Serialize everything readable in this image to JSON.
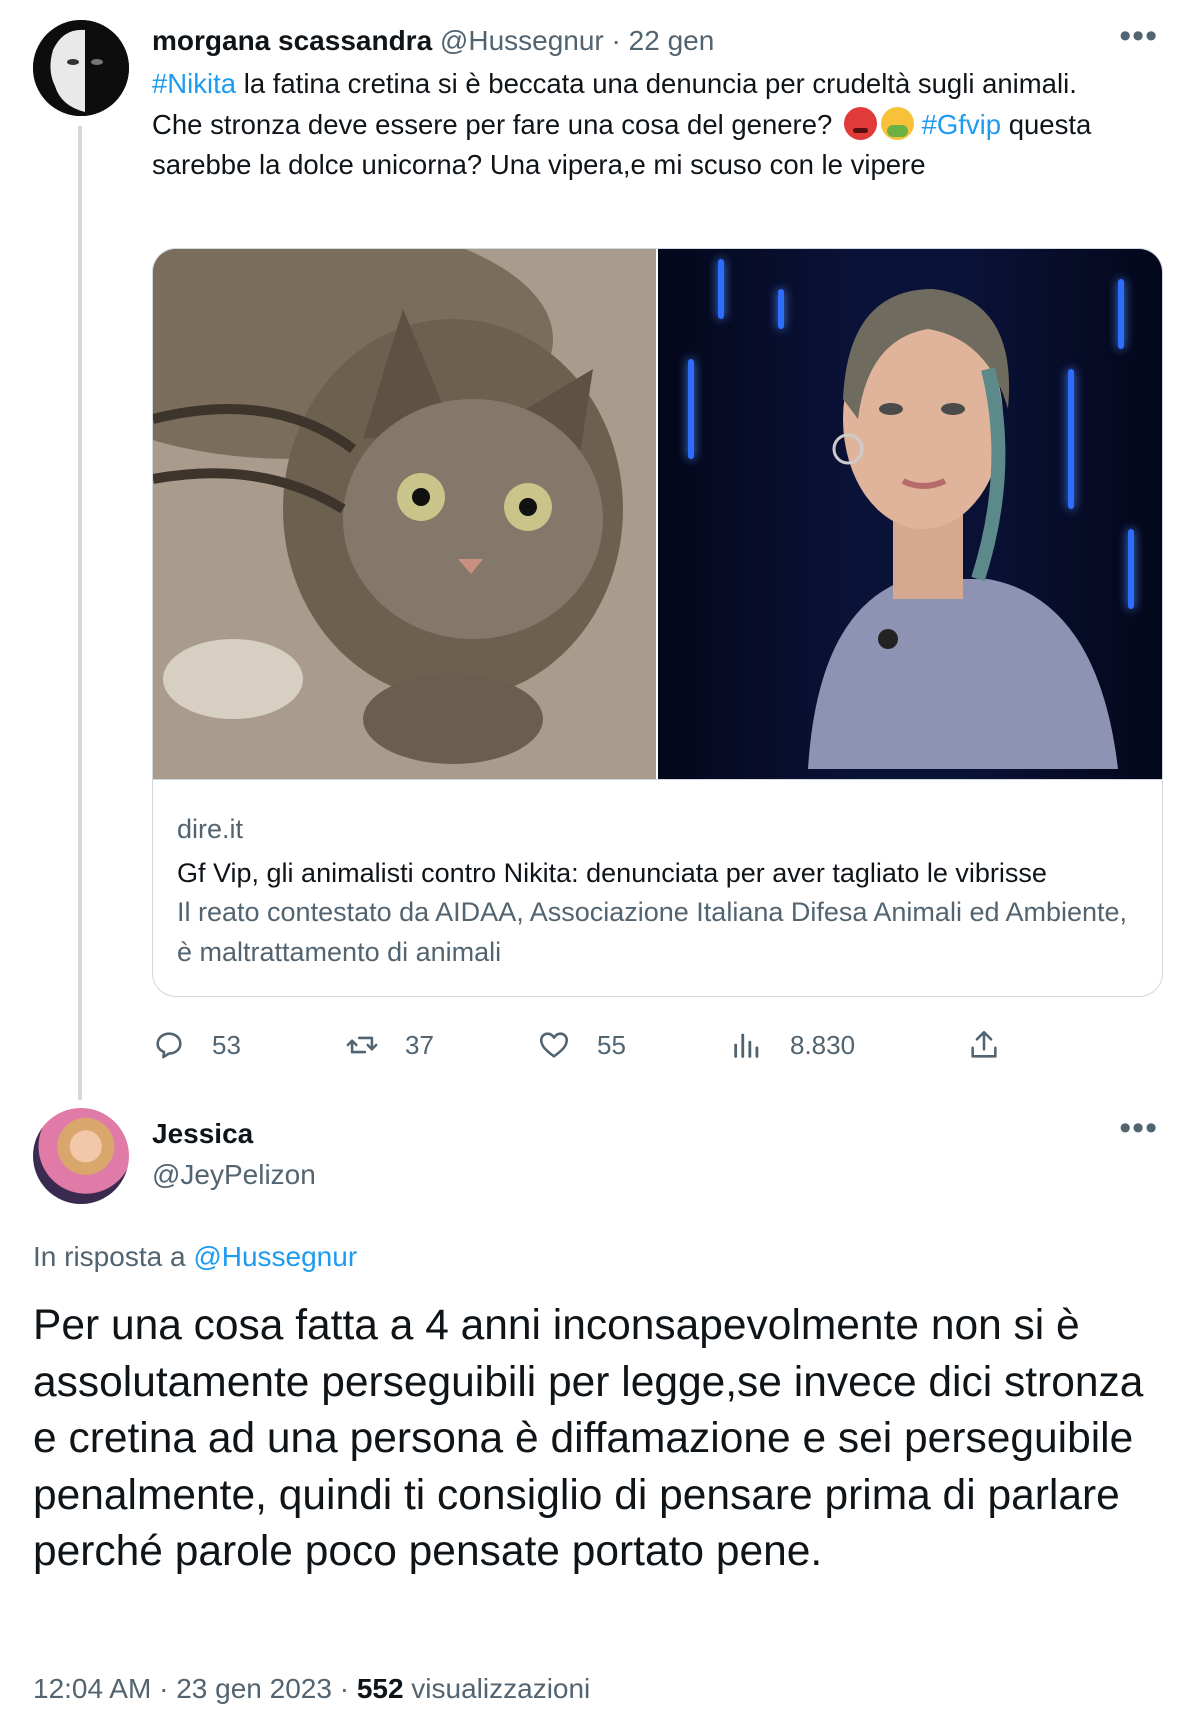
{
  "tweet1": {
    "author_name": "morgana scassandra",
    "author_handle": "@Hussegnur",
    "separator": " · ",
    "date": "22 gen",
    "text": {
      "hashtag1": "#Nikita",
      "part1": " la fatina cretina si è beccata una denuncia per crudeltà sugli animali. Che stronza deve essere per fare una cosa del genere? ",
      "hashtag2": "#Gfvip",
      "part2": " questa sarebbe la dolce unicorna? Una vipera,e mi scuso con le vipere"
    },
    "emojis": [
      "angry-face-emoji",
      "vomiting-face-emoji"
    ],
    "card": {
      "domain": "dire.it",
      "title": "Gf Vip, gli animalisti contro Nikita: denunciata per aver tagliato le vibrisse",
      "description": "Il reato contestato da AIDAA, Associazione Italiana Difesa Animali ed Ambiente, è maltrattamento di animali",
      "image_left": "tabby-cat-photo",
      "image_right": "woman-in-sparkly-outfit-photo"
    },
    "stats": {
      "replies": "53",
      "retweets": "37",
      "likes": "55",
      "views": "8.830"
    }
  },
  "tweet2": {
    "author_name": "Jessica",
    "author_handle": "@JeyPelizon",
    "reply_prefix": "In risposta a ",
    "reply_mention": "@Hussegnur",
    "text": "Per una cosa fatta a 4 anni inconsapevolmente non si è assolutamente perseguibili  per legge,se invece dici stronza e cretina ad una persona è diffamazione e sei perseguibile penalmente, quindi ti consiglio di pensare prima di parlare perché parole poco pensate portato pene.",
    "time": "12:04 AM",
    "date": "23 gen 2023",
    "separator": " · ",
    "views_count": "552",
    "views_label": " visualizzazioni"
  },
  "icons": {
    "more": "more-options-icon",
    "reply": "reply-icon",
    "retweet": "retweet-icon",
    "like": "heart-icon",
    "views": "views-icon",
    "share": "share-icon"
  },
  "colors": {
    "accent": "#1d9bf0",
    "secondary_text": "#536471",
    "primary_text": "#0f1419",
    "border": "#cfd9de"
  }
}
